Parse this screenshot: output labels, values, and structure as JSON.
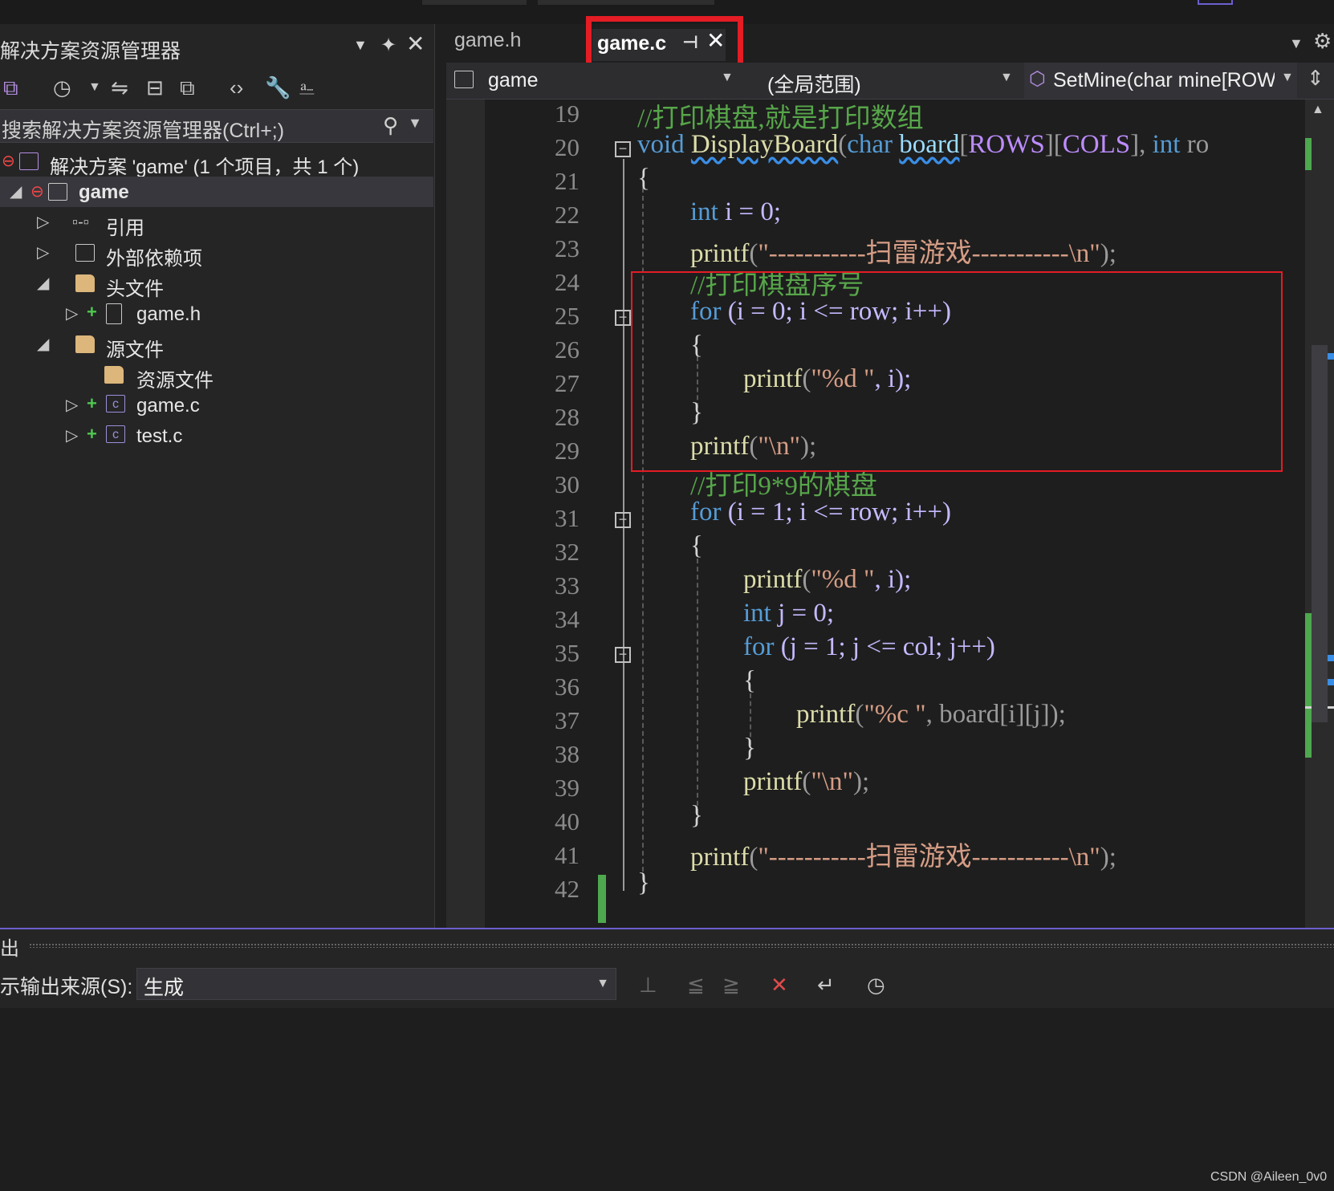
{
  "solution_explorer": {
    "title": "解决方案资源管理器",
    "search_placeholder": "搜索解决方案资源管理器(Ctrl+;)",
    "solution_label": "解决方案 'game' (1 个项目，共 1 个)",
    "project": "game",
    "references": "引用",
    "external_deps": "外部依赖项",
    "header_files": "头文件",
    "header_file_1": "game.h",
    "source_files": "源文件",
    "resource_files": "资源文件",
    "source_file_1": "game.c",
    "source_file_2": "test.c"
  },
  "tabs": {
    "inactive": "game.h",
    "active": "game.c"
  },
  "navbar": {
    "project": "game",
    "scope": "(全局范围)",
    "member": "SetMine(char mine[ROW"
  },
  "code": {
    "line_numbers": [
      "19",
      "20",
      "21",
      "22",
      "23",
      "24",
      "25",
      "26",
      "27",
      "28",
      "29",
      "30",
      "31",
      "32",
      "33",
      "34",
      "35",
      "36",
      "37",
      "38",
      "39",
      "40",
      "41",
      "42"
    ],
    "l19": "//打印棋盘,就是打印数组",
    "l20_void": "void",
    "l20_fn": "DisplayBoard",
    "l20_p1": "(",
    "l20_char": "char",
    "l20_board": "board",
    "l20_p2": "[",
    "l20_rows": "ROWS",
    "l20_p3": "][",
    "l20_cols": "COLS",
    "l20_p4": "],",
    "l20_int": "int",
    "l20_ro": "ro",
    "l21": "{",
    "l22_int": "int",
    "l22_rest": " i = 0;",
    "l23_fn": "printf",
    "l23_p1": "(",
    "l23_str": "\"-----------扫雷游戏-----------\\n\"",
    "l23_p2": ");",
    "l24": "//打印棋盘序号",
    "l25_for": "for",
    "l25_rest": " (i = 0; i <= row; i++)",
    "l26": "{",
    "l27_fn": "printf",
    "l27_p1": "(",
    "l27_str": "\"%d \"",
    "l27_p2": ", i);",
    "l28": "}",
    "l29_fn": "printf",
    "l29_p1": "(",
    "l29_str": "\"\\n\"",
    "l29_p2": ");",
    "l30": "//打印9*9的棋盘",
    "l31_for": "for",
    "l31_rest": " (i = 1; i <= row; i++)",
    "l32": "{",
    "l33_fn": "printf",
    "l33_p1": "(",
    "l33_str": "\"%d \"",
    "l33_p2": ", i);",
    "l34_int": "int",
    "l34_rest": " j = 0;",
    "l35_for": "for",
    "l35_rest": " (j = 1; j <= col; j++)",
    "l36": "{",
    "l37_fn": "printf",
    "l37_p1": "(",
    "l37_str": "\"%c \"",
    "l37_p2": ", board[i][j]);",
    "l38": "}",
    "l39_fn": "printf",
    "l39_p1": "(",
    "l39_str": "\"\\n\"",
    "l39_p2": ");",
    "l40": "}",
    "l41_fn": "printf",
    "l41_p1": "(",
    "l41_str": "\"-----------扫雷游戏-----------\\n\"",
    "l41_p2": ");",
    "l42": "}"
  },
  "output": {
    "title": "出",
    "source_label": "示输出来源(S):",
    "source_value": "生成"
  },
  "watermark": "CSDN @Aileen_0v0",
  "colors": {
    "highlight_red": "#e41c24",
    "keyword": "#569cd6",
    "function": "#dcdcaa",
    "comment": "#57a64a",
    "string": "#d69d85",
    "change_bar": "#4ea84e"
  }
}
